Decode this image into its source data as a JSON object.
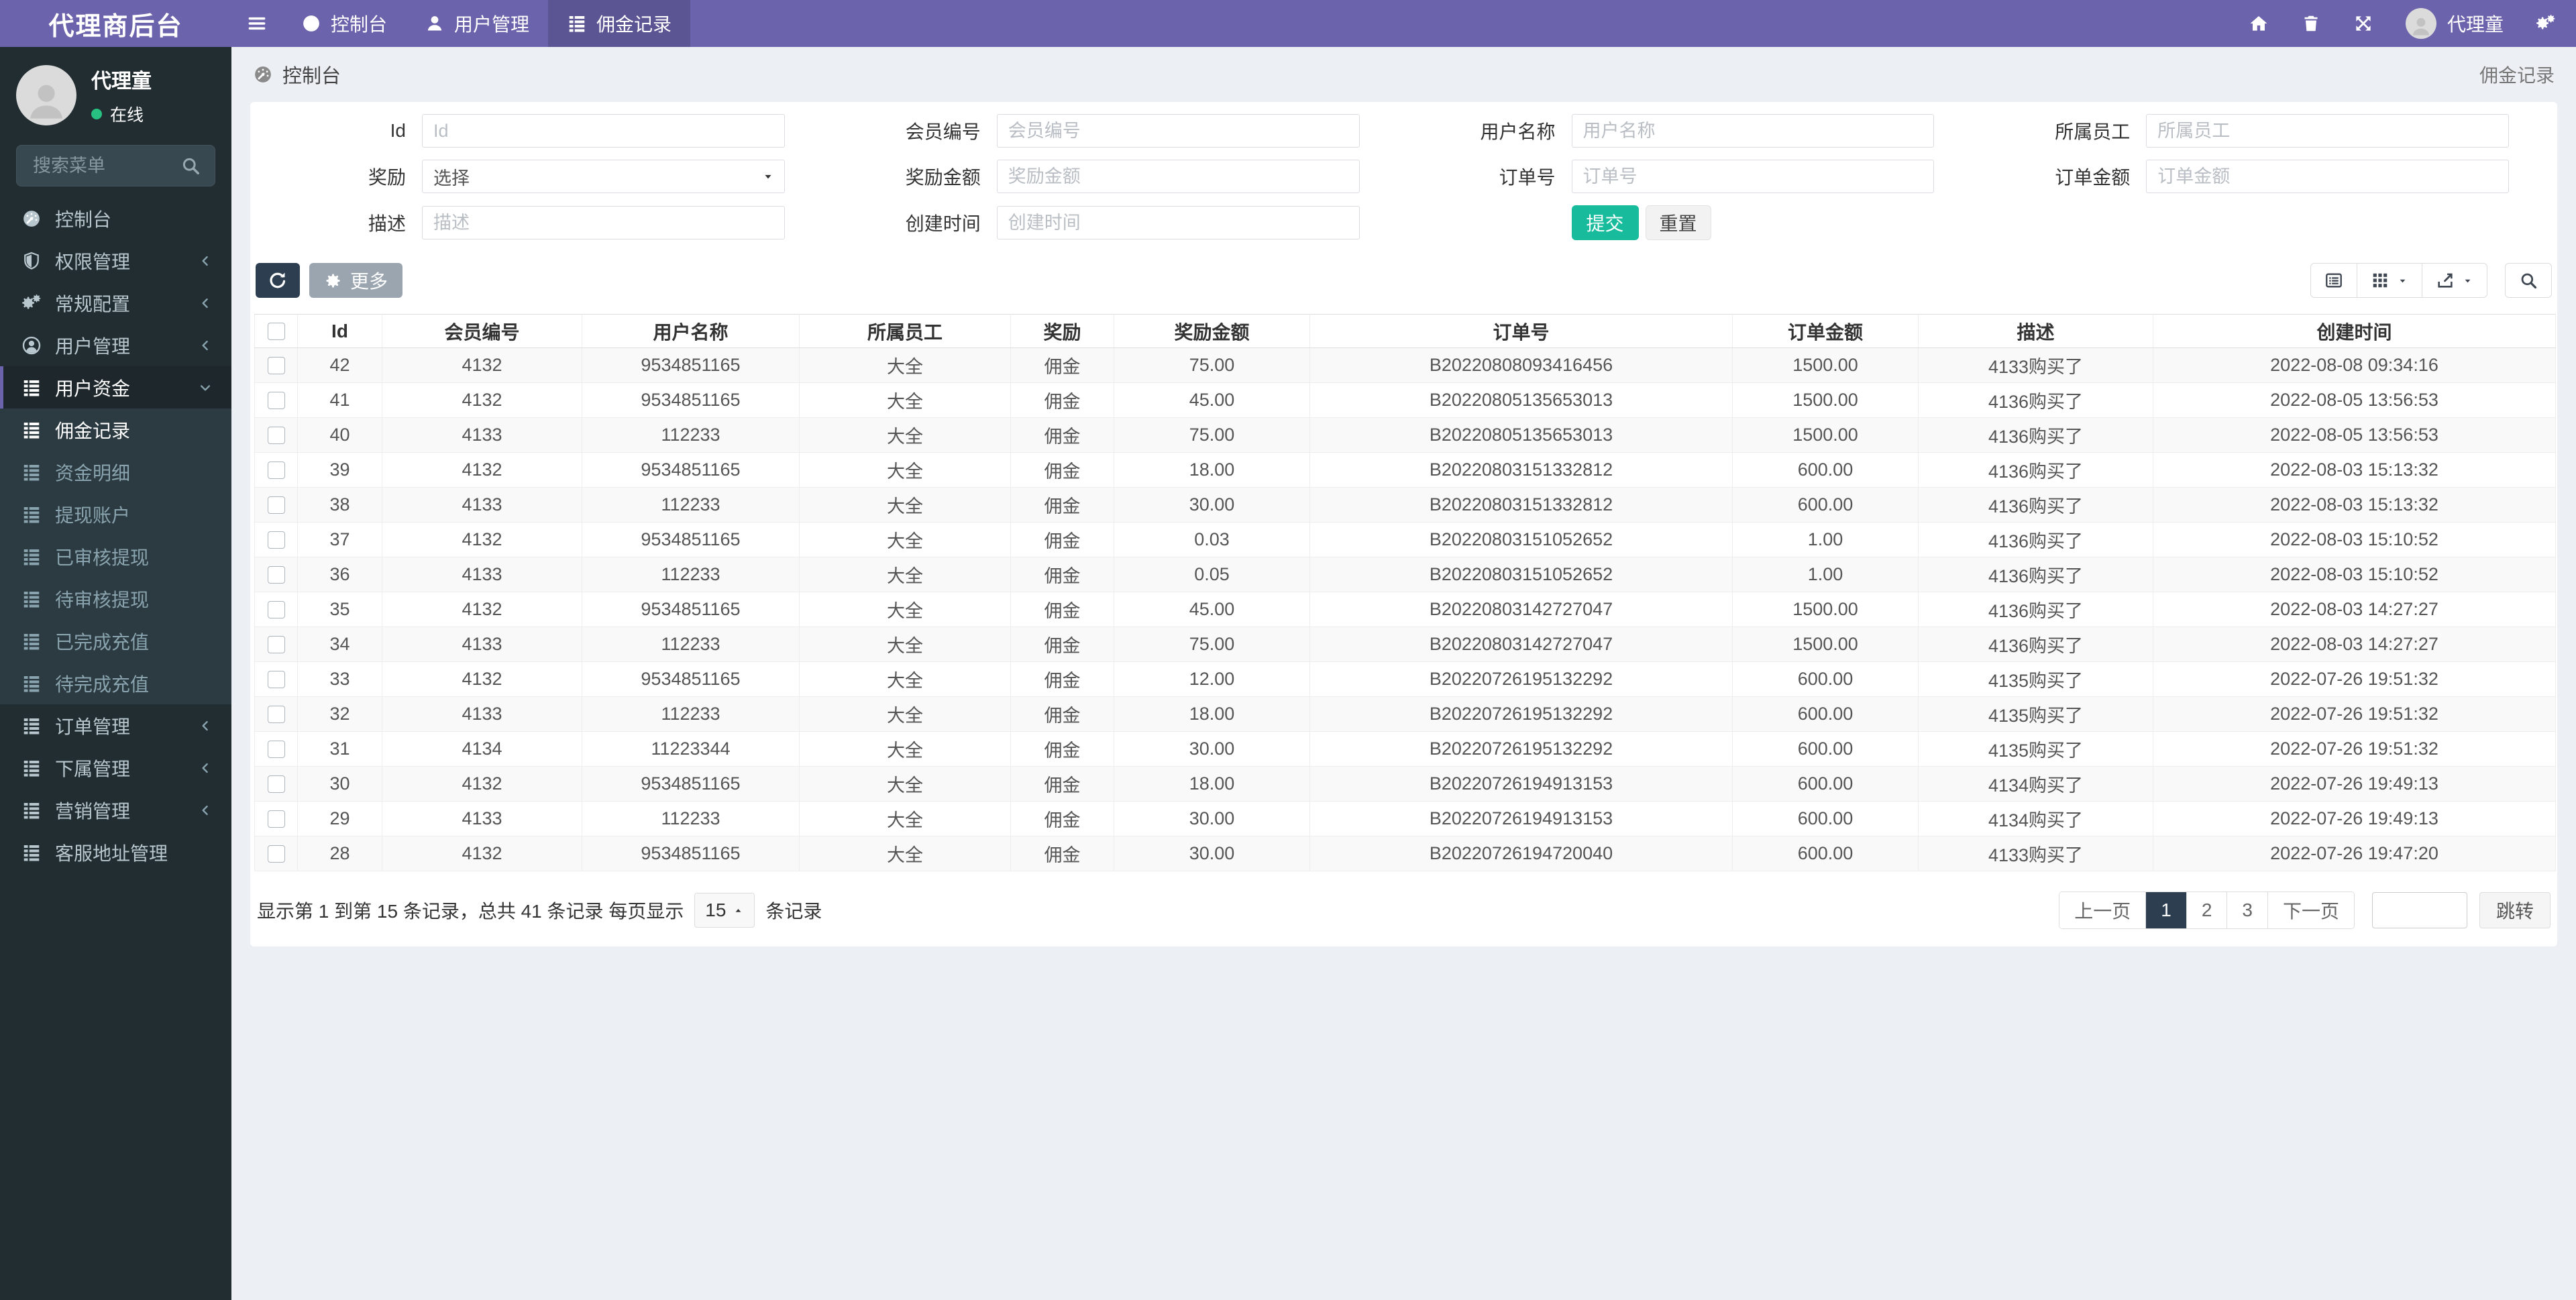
{
  "app": {
    "logo": "代理商后台"
  },
  "colors": {
    "purple": "#6b63ab",
    "purple_dark": "#5c5593",
    "sidebar_dark": "#222d32",
    "submenu": "#2c3b41",
    "green": "#18bc9c",
    "navy": "#2c3e50",
    "page_bg": "#ecf0f5",
    "online_green": "#27c281"
  },
  "navbar": {
    "tabs": [
      {
        "slug": "dashboard",
        "label": "控制台",
        "icon": "gauge-icon",
        "active": false
      },
      {
        "slug": "user-management",
        "label": "用户管理",
        "icon": "user-icon",
        "active": false
      },
      {
        "slug": "commission-records",
        "label": "佣金记录",
        "icon": "list-icon",
        "active": true
      }
    ],
    "right_icons": [
      {
        "slug": "home",
        "icon": "home-icon"
      },
      {
        "slug": "clear-cache",
        "icon": "trash-icon"
      },
      {
        "slug": "fullscreen",
        "icon": "expand-icon"
      }
    ],
    "user": "代理童",
    "settings_icon": "gears-icon"
  },
  "sidebar": {
    "user": {
      "name": "代理童",
      "status": "在线"
    },
    "search_placeholder": "搜索菜单",
    "menu": [
      {
        "slug": "dashboard",
        "label": "控制台",
        "icon": "gauge-icon"
      },
      {
        "slug": "permissions",
        "label": "权限管理",
        "icon": "shield-icon",
        "chevron": "left"
      },
      {
        "slug": "general-config",
        "label": "常规配置",
        "icon": "gears-icon",
        "chevron": "left"
      },
      {
        "slug": "user-management",
        "label": "用户管理",
        "icon": "user-circle-icon",
        "chevron": "left"
      },
      {
        "slug": "user-funds",
        "label": "用户资金",
        "icon": "list-icon",
        "chevron": "down",
        "open": true,
        "children": [
          {
            "slug": "commission-records",
            "label": "佣金记录",
            "icon": "list-icon",
            "active": true
          },
          {
            "slug": "fund-details",
            "label": "资金明细",
            "icon": "list-icon"
          },
          {
            "slug": "withdrawal-accounts",
            "label": "提现账户",
            "icon": "list-icon"
          },
          {
            "slug": "approved-withdrawals",
            "label": "已审核提现",
            "icon": "list-icon"
          },
          {
            "slug": "pending-withdrawals",
            "label": "待审核提现",
            "icon": "list-icon"
          },
          {
            "slug": "completed-recharges",
            "label": "已完成充值",
            "icon": "list-icon"
          },
          {
            "slug": "pending-recharges",
            "label": "待完成充值",
            "icon": "list-icon"
          }
        ]
      },
      {
        "slug": "order-management",
        "label": "订单管理",
        "icon": "list-icon",
        "chevron": "left"
      },
      {
        "slug": "subordinate-management",
        "label": "下属管理",
        "icon": "list-icon",
        "chevron": "left"
      },
      {
        "slug": "marketing-management",
        "label": "营销管理",
        "icon": "list-icon",
        "chevron": "left"
      },
      {
        "slug": "service-address-management",
        "label": "客服地址管理",
        "icon": "list-icon"
      }
    ]
  },
  "breadcrumb": {
    "left": "控制台",
    "left_icon": "gauge-icon",
    "right": "佣金记录"
  },
  "filters": {
    "fields": [
      {
        "slug": "id",
        "label": "Id",
        "type": "text",
        "placeholder": "Id",
        "value": ""
      },
      {
        "slug": "member-no",
        "label": "会员编号",
        "type": "text",
        "placeholder": "会员编号",
        "value": ""
      },
      {
        "slug": "user-name",
        "label": "用户名称",
        "type": "text",
        "placeholder": "用户名称",
        "value": ""
      },
      {
        "slug": "staff",
        "label": "所属员工",
        "type": "text",
        "placeholder": "所属员工",
        "value": ""
      },
      {
        "slug": "reward",
        "label": "奖励",
        "type": "select",
        "value": "选择"
      },
      {
        "slug": "reward-amount",
        "label": "奖励金额",
        "type": "text",
        "placeholder": "奖励金额",
        "value": ""
      },
      {
        "slug": "order-no",
        "label": "订单号",
        "type": "text",
        "placeholder": "订单号",
        "value": ""
      },
      {
        "slug": "order-amount",
        "label": "订单金额",
        "type": "text",
        "placeholder": "订单金额",
        "value": ""
      },
      {
        "slug": "description",
        "label": "描述",
        "type": "text",
        "placeholder": "描述",
        "value": ""
      },
      {
        "slug": "created-at",
        "label": "创建时间",
        "type": "text",
        "placeholder": "创建时间",
        "value": ""
      }
    ],
    "buttons": {
      "submit": "提交",
      "reset": "重置"
    }
  },
  "toolbar": {
    "refresh_icon": "refresh-icon",
    "more_label": "更多",
    "more_icon": "gear-icon",
    "view_buttons": [
      {
        "slug": "toggle-pagination",
        "icon": "list-alt-icon",
        "caret": false
      },
      {
        "slug": "columns",
        "icon": "th-icon",
        "caret": true
      },
      {
        "slug": "export",
        "icon": "export-icon",
        "caret": true
      },
      {
        "slug": "search",
        "icon": "search-icon",
        "caret": false,
        "separate": true
      }
    ]
  },
  "table": {
    "columns": [
      "Id",
      "会员编号",
      "用户名称",
      "所属员工",
      "奖励",
      "奖励金额",
      "订单号",
      "订单金额",
      "描述",
      "创建时间"
    ],
    "rows": [
      [
        "42",
        "4132",
        "9534851165",
        "大全",
        "佣金",
        "75.00",
        "B20220808093416456",
        "1500.00",
        "4133购买了",
        "2022-08-08 09:34:16"
      ],
      [
        "41",
        "4132",
        "9534851165",
        "大全",
        "佣金",
        "45.00",
        "B20220805135653013",
        "1500.00",
        "4136购买了",
        "2022-08-05 13:56:53"
      ],
      [
        "40",
        "4133",
        "112233",
        "大全",
        "佣金",
        "75.00",
        "B20220805135653013",
        "1500.00",
        "4136购买了",
        "2022-08-05 13:56:53"
      ],
      [
        "39",
        "4132",
        "9534851165",
        "大全",
        "佣金",
        "18.00",
        "B20220803151332812",
        "600.00",
        "4136购买了",
        "2022-08-03 15:13:32"
      ],
      [
        "38",
        "4133",
        "112233",
        "大全",
        "佣金",
        "30.00",
        "B20220803151332812",
        "600.00",
        "4136购买了",
        "2022-08-03 15:13:32"
      ],
      [
        "37",
        "4132",
        "9534851165",
        "大全",
        "佣金",
        "0.03",
        "B20220803151052652",
        "1.00",
        "4136购买了",
        "2022-08-03 15:10:52"
      ],
      [
        "36",
        "4133",
        "112233",
        "大全",
        "佣金",
        "0.05",
        "B20220803151052652",
        "1.00",
        "4136购买了",
        "2022-08-03 15:10:52"
      ],
      [
        "35",
        "4132",
        "9534851165",
        "大全",
        "佣金",
        "45.00",
        "B20220803142727047",
        "1500.00",
        "4136购买了",
        "2022-08-03 14:27:27"
      ],
      [
        "34",
        "4133",
        "112233",
        "大全",
        "佣金",
        "75.00",
        "B20220803142727047",
        "1500.00",
        "4136购买了",
        "2022-08-03 14:27:27"
      ],
      [
        "33",
        "4132",
        "9534851165",
        "大全",
        "佣金",
        "12.00",
        "B20220726195132292",
        "600.00",
        "4135购买了",
        "2022-07-26 19:51:32"
      ],
      [
        "32",
        "4133",
        "112233",
        "大全",
        "佣金",
        "18.00",
        "B20220726195132292",
        "600.00",
        "4135购买了",
        "2022-07-26 19:51:32"
      ],
      [
        "31",
        "4134",
        "11223344",
        "大全",
        "佣金",
        "30.00",
        "B20220726195132292",
        "600.00",
        "4135购买了",
        "2022-07-26 19:51:32"
      ],
      [
        "30",
        "4132",
        "9534851165",
        "大全",
        "佣金",
        "18.00",
        "B20220726194913153",
        "600.00",
        "4134购买了",
        "2022-07-26 19:49:13"
      ],
      [
        "29",
        "4133",
        "112233",
        "大全",
        "佣金",
        "30.00",
        "B20220726194913153",
        "600.00",
        "4134购买了",
        "2022-07-26 19:49:13"
      ],
      [
        "28",
        "4132",
        "9534851165",
        "大全",
        "佣金",
        "30.00",
        "B20220726194720040",
        "600.00",
        "4133购买了",
        "2022-07-26 19:47:20"
      ]
    ]
  },
  "footer": {
    "summary_prefix": "显示第 1 到第 15 条记录，总共 41 条记录 每页显示",
    "page_size": "15",
    "summary_suffix": "条记录"
  },
  "pagination": {
    "prev": "上一页",
    "pages": [
      "1",
      "2",
      "3"
    ],
    "active": "1",
    "next": "下一页",
    "jump": "跳转"
  }
}
